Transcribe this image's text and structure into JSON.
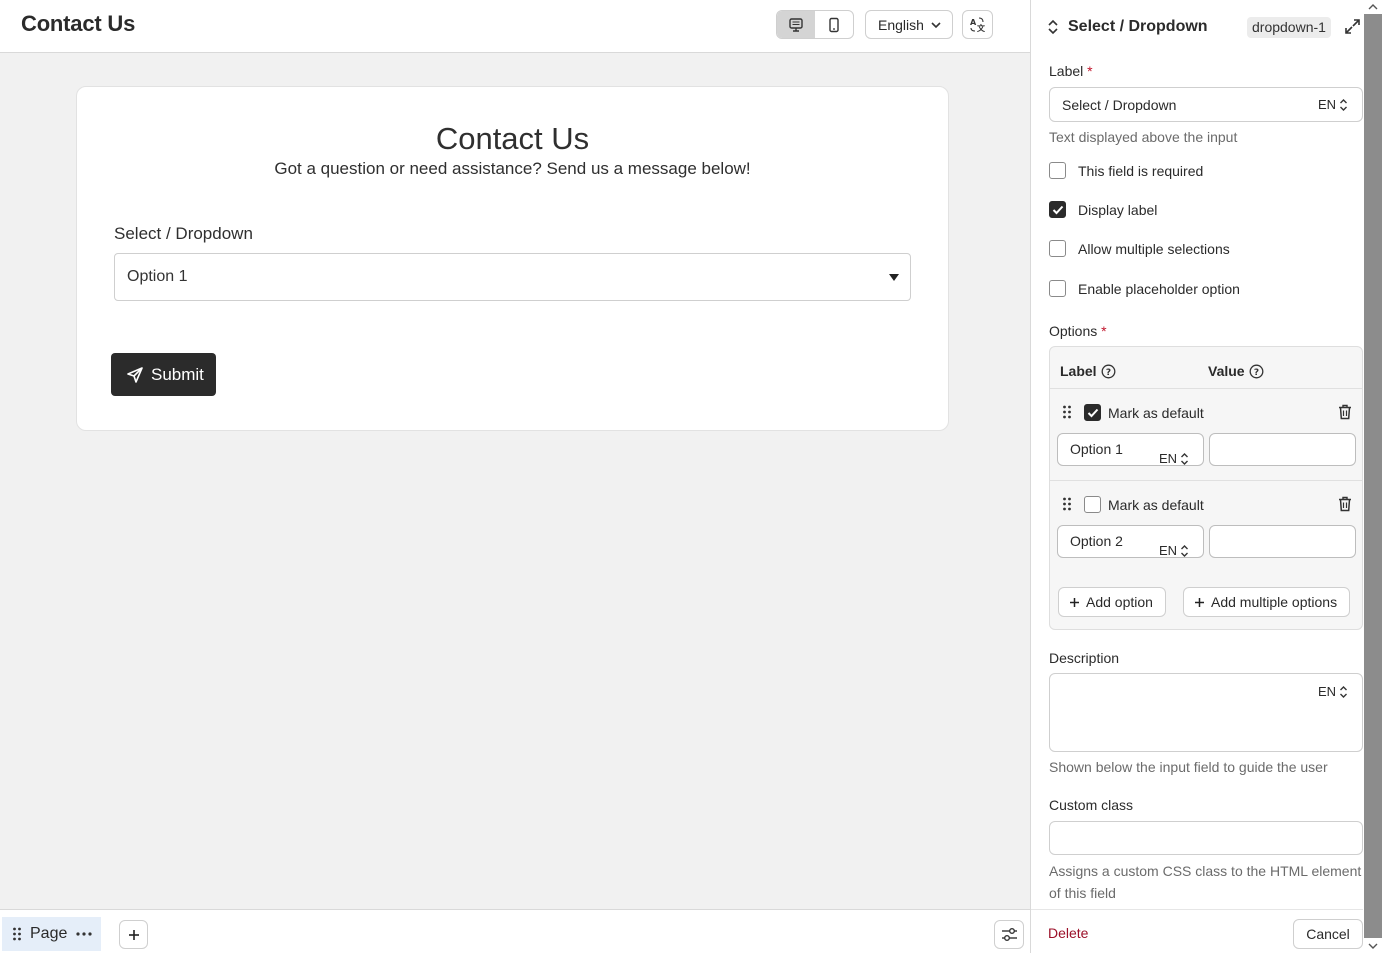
{
  "header": {
    "title": "Contact Us",
    "language": "English"
  },
  "form": {
    "title": "Contact Us",
    "subtitle": "Got a question or need assistance? Send us a message below!",
    "field_label": "Select / Dropdown",
    "field_value": "Option 1",
    "submit_label": "Submit"
  },
  "bottombar": {
    "page_label": "Page"
  },
  "sidebar": {
    "title": "Select / Dropdown",
    "badge": "dropdown-1",
    "label_title": "Label",
    "label_value": "Select / Dropdown",
    "lang_code": "EN",
    "label_hint": "Text displayed above the input",
    "checkboxes": [
      {
        "label": "This field is required",
        "checked": false
      },
      {
        "label": "Display label",
        "checked": true
      },
      {
        "label": "Allow multiple selections",
        "checked": false
      },
      {
        "label": "Enable placeholder option",
        "checked": false
      }
    ],
    "options_title": "Options",
    "options_col_label": "Label",
    "options_col_value": "Value",
    "options": [
      {
        "mark_label": "Mark as default",
        "is_default": true,
        "label": "Option 1",
        "value": ""
      },
      {
        "mark_label": "Mark as default",
        "is_default": false,
        "label": "Option 2",
        "value": ""
      }
    ],
    "add_option": "Add option",
    "add_multiple": "Add multiple options",
    "description_title": "Description",
    "description_value": "",
    "description_hint": "Shown below the input field to guide the user",
    "custom_class_title": "Custom class",
    "custom_class_value": "",
    "custom_class_hint": "Assigns a custom CSS class to the HTML element of this field",
    "delete_label": "Delete",
    "cancel_label": "Cancel"
  },
  "colors": {
    "accent_dark": "#2b2b2b",
    "danger": "#9c1029",
    "required": "#c0142b",
    "page_tab_bg": "#e5eef9"
  }
}
